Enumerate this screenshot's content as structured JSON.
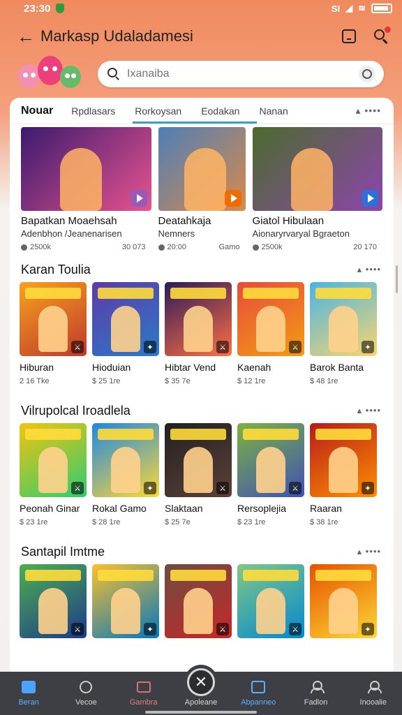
{
  "status": {
    "time": "23:30",
    "signal_text": "SI"
  },
  "header": {
    "title": "Markasp Udaladamesi"
  },
  "search": {
    "placeholder": "Ixanaiba"
  },
  "tabs": [
    {
      "label": "Nouar"
    },
    {
      "label": "Rpdlasars"
    },
    {
      "label": "Rorkoysan"
    },
    {
      "label": "Eodakan"
    },
    {
      "label": "Nanan"
    }
  ],
  "featured": [
    {
      "title": "Bapatkan Moaehsah",
      "subtitle": "Adenbhon /Jeanenarisen",
      "count": "2500k",
      "stat": "30 073",
      "colors": [
        "#3b1a6e",
        "#e8538f"
      ],
      "button_color": "#9b59b6"
    },
    {
      "title": "Deatahkaja",
      "subtitle": "Nemners",
      "count": "20:00",
      "stat": "Gamo",
      "colors": [
        "#4e7fb8",
        "#d98a4a"
      ],
      "button_color": "#ef6c00"
    },
    {
      "title": "Giatol Hibulaan",
      "subtitle": "Aionaryrvaryal Bgraeton",
      "count": "2500k",
      "stat": "20 170",
      "colors": [
        "#4b6b2d",
        "#8e44ad"
      ],
      "button_color": "#2f6fd6"
    }
  ],
  "sections": [
    {
      "title": "Karan Toulia",
      "tiles": [
        {
          "name": "Hiburan",
          "price": "2 16 Tke",
          "colors": [
            "#f6a21e",
            "#c0392b"
          ]
        },
        {
          "name": "Hioduian",
          "price": "$ 25 1re",
          "colors": [
            "#5e3aa8",
            "#2a7bc8"
          ]
        },
        {
          "name": "Hibtar Vend",
          "price": "$ 35 7e",
          "colors": [
            "#2c1b5a",
            "#ff7043"
          ]
        },
        {
          "name": "Kaenah",
          "price": "$ 12 1re",
          "colors": [
            "#e74c3c",
            "#f39c12"
          ]
        },
        {
          "name": "Barok Banta",
          "price": "$ 48 1re",
          "colors": [
            "#48b5e6",
            "#f9d56e"
          ]
        }
      ]
    },
    {
      "title": "Vilrupolcal Iroadlela",
      "tiles": [
        {
          "name": "Peonah Ginar",
          "price": "$ 23 1re",
          "colors": [
            "#f1c40f",
            "#2ecc71"
          ]
        },
        {
          "name": "Rokal Gamo",
          "price": "$ 28 1re",
          "colors": [
            "#1e88e5",
            "#fdd835"
          ]
        },
        {
          "name": "Slaktaan",
          "price": "$ 25 7e",
          "colors": [
            "#212121",
            "#5d4037"
          ]
        },
        {
          "name": "Rersoplejia",
          "price": "$ 23 1re",
          "colors": [
            "#7cb342",
            "#3f51b5"
          ]
        },
        {
          "name": "Raaran",
          "price": "$ 38 1re",
          "colors": [
            "#b71c1c",
            "#ff8f00"
          ]
        }
      ]
    },
    {
      "title": "Santapil Imtme",
      "tiles": [
        {
          "name": "",
          "price": "",
          "colors": [
            "#4caf50",
            "#1e3a8a"
          ]
        },
        {
          "name": "",
          "price": "",
          "colors": [
            "#fbc02d",
            "#0277bd"
          ]
        },
        {
          "name": "",
          "price": "",
          "colors": [
            "#6d4c41",
            "#c62828"
          ]
        },
        {
          "name": "",
          "price": "",
          "colors": [
            "#81c784",
            "#0288d1"
          ]
        },
        {
          "name": "",
          "price": "",
          "colors": [
            "#e65100",
            "#fdd835"
          ]
        }
      ]
    }
  ],
  "bottom_nav": [
    {
      "label": "Beran",
      "icon": "home-icon"
    },
    {
      "label": "Vecoe",
      "icon": "clock-icon"
    },
    {
      "label": "Gambra",
      "icon": "box-icon"
    },
    {
      "label": "Apoleane",
      "icon": "close-icon"
    },
    {
      "label": "Abpanneo",
      "icon": "apps-icon"
    },
    {
      "label": "Fadlon",
      "icon": "profile-icon"
    },
    {
      "label": "Inooalie",
      "icon": "account-icon"
    }
  ]
}
